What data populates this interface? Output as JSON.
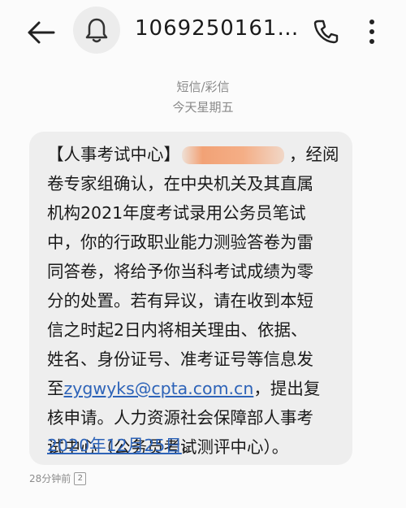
{
  "header": {
    "sender_number": "1069250161…"
  },
  "thread": {
    "message_type": "短信/彩信",
    "date_label": "今天星期五"
  },
  "message": {
    "line1_a": "【人事考试中心】",
    "line1_b": "，经阅",
    "line2": "卷专家组确认，在中央机关及其直属",
    "line3": "机构2021年度考试录用公务员笔试",
    "line4": "中，你的行政职业能力测验答卷为雷",
    "line5": "同答卷，将给予你当科考试成绩为零",
    "line6": "分的处置。若有异议，请在收到本短",
    "line7": "信之时起2日内将相关理由、依据、",
    "line8": "姓名、身份证号、准考证号等信息发",
    "line9_a": "至",
    "line9_email": "zygwyks@cpta.com.cn",
    "line9_b": "，提出复",
    "line10": "核申请。人力资源社会保障部人事考",
    "line11": "试中心（公务员考试测评中心）。",
    "line12_date": "2020年12月25日",
    "line12_b": "。"
  },
  "footer": {
    "time_ago": "28分钟前",
    "sim_slot": "2"
  },
  "colors": {
    "bubble": "#eeeeee",
    "link": "#2d63b8",
    "redaction": "#f2a276"
  }
}
